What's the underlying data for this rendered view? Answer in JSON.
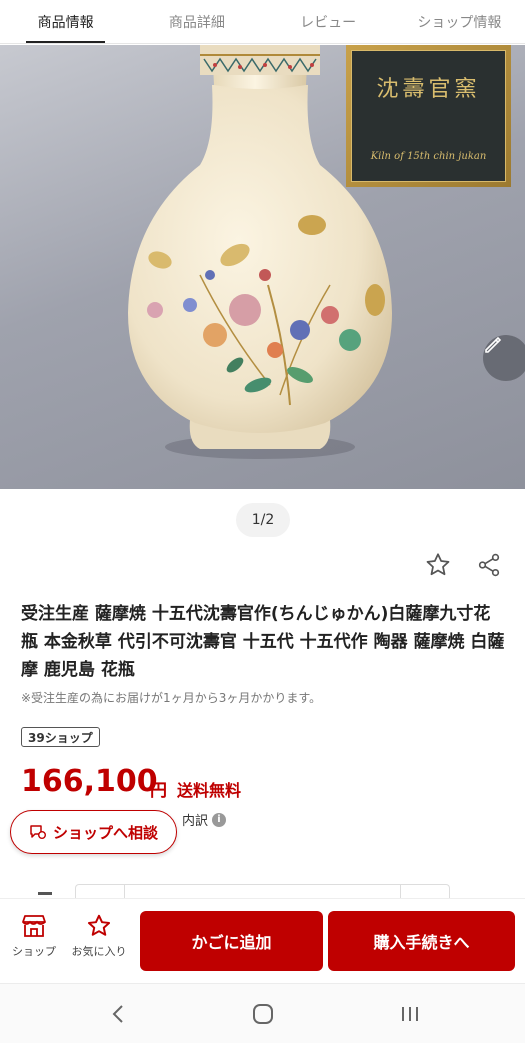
{
  "tabs": [
    {
      "label": "商品情報"
    },
    {
      "label": "商品詳細"
    },
    {
      "label": "レビュー"
    },
    {
      "label": "ショップ情報"
    }
  ],
  "hero": {
    "kiln_title": "沈壽官窯",
    "kiln_subtitle": "Kiln of 15th chin jukan",
    "pager": "1/2"
  },
  "product": {
    "title": "受注生産 薩摩焼 十五代沈壽官作(ちんじゅかん)白薩摩九寸花瓶 本金秋草 代引不可沈壽官 十五代 十五代作 陶器 薩摩焼 白薩摩 鹿児島 花瓶",
    "note": "※受注生産の為にお届けが1ヶ月から3ヶ月かかります。",
    "badge": "39ショップ",
    "price": "166,100",
    "price_unit": "円",
    "shipping": "送料無料",
    "breakdown": "内訳",
    "consult_label": "ショップへ相談"
  },
  "bottom_bar": {
    "shop_label": "ショップ",
    "favorite_label": "お気に入り",
    "cart_label": "かごに追加",
    "buy_label": "購入手続きへ"
  },
  "colors": {
    "accent": "#bf0000"
  },
  "icons": [
    "star-icon",
    "share-icon",
    "pencil-icon",
    "chat-icon",
    "shop-icon",
    "back-icon",
    "home-icon",
    "recents-icon"
  ]
}
